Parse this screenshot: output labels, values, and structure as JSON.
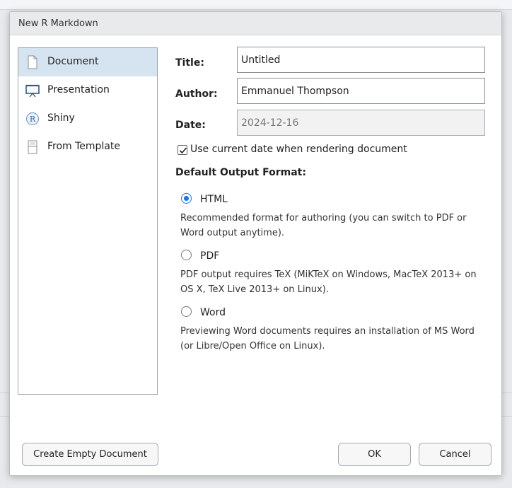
{
  "dialog": {
    "title": "New R Markdown"
  },
  "sidebar": {
    "items": [
      {
        "label": "Document",
        "icon": "document-icon",
        "selected": true
      },
      {
        "label": "Presentation",
        "icon": "presentation-icon",
        "selected": false
      },
      {
        "label": "Shiny",
        "icon": "shiny-r-icon",
        "selected": false
      },
      {
        "label": "From Template",
        "icon": "template-icon",
        "selected": false
      }
    ]
  },
  "form": {
    "title_label": "Title:",
    "title_value": "Untitled",
    "author_label": "Author:",
    "author_value": "Emmanuel Thompson",
    "date_label": "Date:",
    "date_value": "2024-12-16",
    "use_current_date_label": "Use current date when rendering document",
    "use_current_date_checked": true,
    "output_format_heading": "Default Output Format:"
  },
  "formats": [
    {
      "label": "HTML",
      "checked": true,
      "description": "Recommended format for authoring (you can switch to PDF or Word output anytime)."
    },
    {
      "label": "PDF",
      "checked": false,
      "description": "PDF output requires TeX (MiKTeX on Windows, MacTeX 2013+ on OS X, TeX Live 2013+ on Linux)."
    },
    {
      "label": "Word",
      "checked": false,
      "description": "Previewing Word documents requires an installation of MS Word (or Libre/Open Office on Linux)."
    }
  ],
  "buttons": {
    "create_empty": "Create Empty Document",
    "ok": "OK",
    "cancel": "Cancel"
  },
  "colors": {
    "selection": "#d6e4f1",
    "radio_accent": "#1a73e8"
  }
}
